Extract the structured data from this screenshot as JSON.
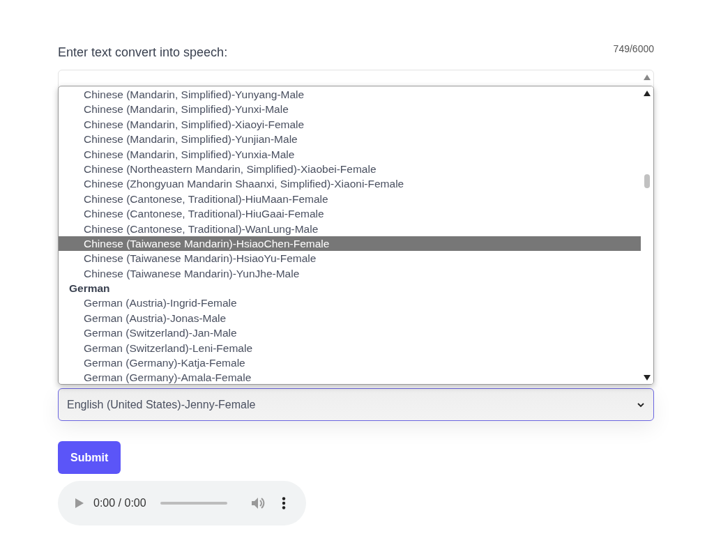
{
  "label": "Enter text convert into speech:",
  "counter": "749/6000",
  "listbox": {
    "items": [
      {
        "kind": "option",
        "text": "Chinese (Mandarin, Simplified)-Yunyang-Male",
        "selected": false
      },
      {
        "kind": "option",
        "text": "Chinese (Mandarin, Simplified)-Yunxi-Male",
        "selected": false
      },
      {
        "kind": "option",
        "text": "Chinese (Mandarin, Simplified)-Xiaoyi-Female",
        "selected": false
      },
      {
        "kind": "option",
        "text": "Chinese (Mandarin, Simplified)-Yunjian-Male",
        "selected": false
      },
      {
        "kind": "option",
        "text": "Chinese (Mandarin, Simplified)-Yunxia-Male",
        "selected": false
      },
      {
        "kind": "option",
        "text": "Chinese (Northeastern Mandarin, Simplified)-Xiaobei-Female",
        "selected": false
      },
      {
        "kind": "option",
        "text": "Chinese (Zhongyuan Mandarin Shaanxi, Simplified)-Xiaoni-Female",
        "selected": false
      },
      {
        "kind": "option",
        "text": "Chinese (Cantonese, Traditional)-HiuMaan-Female",
        "selected": false
      },
      {
        "kind": "option",
        "text": "Chinese (Cantonese, Traditional)-HiuGaai-Female",
        "selected": false
      },
      {
        "kind": "option",
        "text": "Chinese (Cantonese, Traditional)-WanLung-Male",
        "selected": false
      },
      {
        "kind": "option",
        "text": "Chinese (Taiwanese Mandarin)-HsiaoChen-Female",
        "selected": true
      },
      {
        "kind": "option",
        "text": "Chinese (Taiwanese Mandarin)-HsiaoYu-Female",
        "selected": false
      },
      {
        "kind": "option",
        "text": "Chinese (Taiwanese Mandarin)-YunJhe-Male",
        "selected": false
      },
      {
        "kind": "group",
        "text": "German"
      },
      {
        "kind": "option",
        "text": "German (Austria)-Ingrid-Female",
        "selected": false
      },
      {
        "kind": "option",
        "text": "German (Austria)-Jonas-Male",
        "selected": false
      },
      {
        "kind": "option",
        "text": "German (Switzerland)-Jan-Male",
        "selected": false
      },
      {
        "kind": "option",
        "text": "German (Switzerland)-Leni-Female",
        "selected": false
      },
      {
        "kind": "option",
        "text": "German (Germany)-Katja-Female",
        "selected": false
      },
      {
        "kind": "option",
        "text": "German (Germany)-Amala-Female",
        "selected": false
      }
    ]
  },
  "voice_select": {
    "value": "English (United States)-Jenny-Female"
  },
  "submit": "Submit",
  "audio": {
    "time": "0:00 / 0:00"
  }
}
